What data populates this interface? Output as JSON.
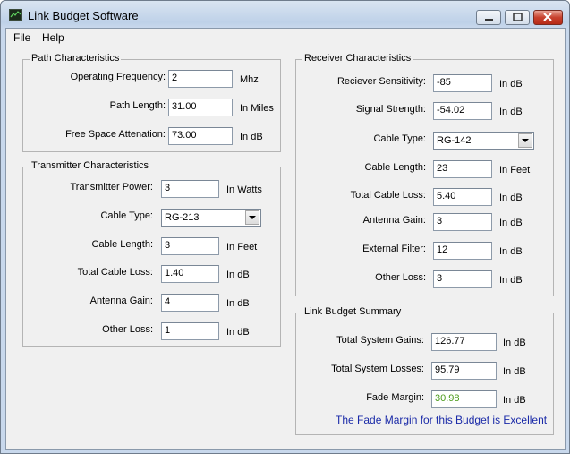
{
  "window": {
    "title": "Link Budget Software"
  },
  "menu": {
    "file": "File",
    "help": "Help"
  },
  "path": {
    "legend": "Path Characteristics",
    "frequency_label": "Operating Frequency:",
    "frequency_value": "2",
    "frequency_unit": "Mhz",
    "length_label": "Path Length:",
    "length_value": "31.00",
    "length_unit": "In Miles",
    "fsa_label": "Free Space Attenation:",
    "fsa_value": "73.00",
    "fsa_unit": "In dB"
  },
  "transmitter": {
    "legend": "Transmitter Characteristics",
    "power_label": "Transmitter Power:",
    "power_value": "3",
    "power_unit": "In Watts",
    "cable_type_label": "Cable Type:",
    "cable_type_value": "RG-213",
    "cable_length_label": "Cable Length:",
    "cable_length_value": "3",
    "cable_length_unit": "In Feet",
    "cable_loss_label": "Total Cable Loss:",
    "cable_loss_value": "1.40",
    "cable_loss_unit": "In dB",
    "antenna_gain_label": "Antenna Gain:",
    "antenna_gain_value": "4",
    "antenna_gain_unit": "In dB",
    "other_loss_label": "Other Loss:",
    "other_loss_value": "1",
    "other_loss_unit": "In dB"
  },
  "receiver": {
    "legend": "Receiver Characteristics",
    "sensitivity_label": "Reciever Sensitivity:",
    "sensitivity_value": "-85",
    "sensitivity_unit": "In dB",
    "signal_label": "Signal Strength:",
    "signal_value": "-54.02",
    "signal_unit": "In dB",
    "cable_type_label": "Cable Type:",
    "cable_type_value": "RG-142",
    "cable_length_label": "Cable Length:",
    "cable_length_value": "23",
    "cable_length_unit": "In Feet",
    "cable_loss_label": "Total Cable Loss:",
    "cable_loss_value": "5.40",
    "cable_loss_unit": "In dB",
    "antenna_gain_label": "Antenna Gain:",
    "antenna_gain_value": "3",
    "antenna_gain_unit": "In dB",
    "filter_label": "External Filter:",
    "filter_value": "12",
    "filter_unit": "In dB",
    "other_loss_label": "Other Loss:",
    "other_loss_value": "3",
    "other_loss_unit": "In dB"
  },
  "summary": {
    "legend": "Link Budget Summary",
    "gains_label": "Total System Gains:",
    "gains_value": "126.77",
    "gains_unit": "In dB",
    "losses_label": "Total System Losses:",
    "losses_value": "95.79",
    "losses_unit": "In dB",
    "fade_label": "Fade Margin:",
    "fade_value": "30.98",
    "fade_unit": "In dB",
    "message": "The Fade Margin for this Budget is Excellent"
  },
  "colors": {
    "fade_margin_text": "#4a9a1a",
    "message_text": "#1a2aa8"
  },
  "icons": {
    "app": "chart-icon",
    "minimize": "minimize-icon",
    "maximize": "maximize-icon",
    "close": "close-icon",
    "dropdown": "chevron-down-icon"
  }
}
